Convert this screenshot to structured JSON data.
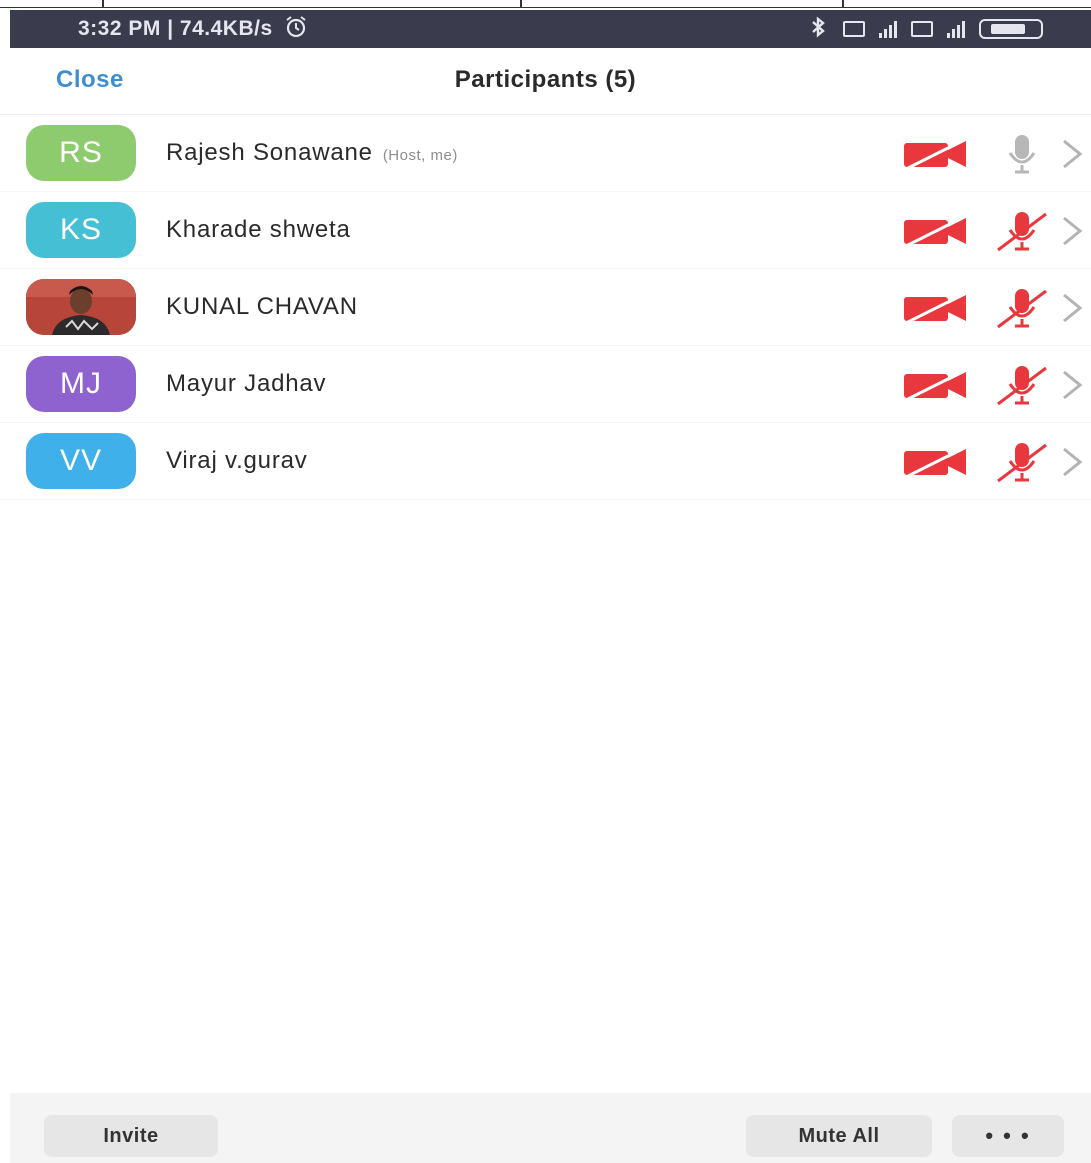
{
  "status_bar": {
    "time_speed": "3:32 PM | 74.4KB/s",
    "icons": [
      "alarm-icon",
      "bluetooth-icon",
      "volte-icon",
      "signal-icon",
      "volte-icon",
      "signal-icon",
      "battery-icon"
    ]
  },
  "header": {
    "close_label": "Close",
    "title": "Participants (5)"
  },
  "participants": [
    {
      "initials": "RS",
      "name": "Rajesh Sonawane",
      "tag": "(Host, me)",
      "avatar_color": "#8ecb6e",
      "video": "off",
      "audio": "unmuted-idle"
    },
    {
      "initials": "KS",
      "name": "Kharade shweta",
      "tag": "",
      "avatar_color": "#45bfd3",
      "video": "off",
      "audio": "muted"
    },
    {
      "initials": "",
      "name": "KUNAL CHAVAN",
      "tag": "",
      "avatar_color": "#b7453a",
      "video": "off",
      "audio": "muted",
      "photo": true
    },
    {
      "initials": "MJ",
      "name": "Mayur Jadhav",
      "tag": "",
      "avatar_color": "#8f63cf",
      "video": "off",
      "audio": "muted"
    },
    {
      "initials": "VV",
      "name": "Viraj v.gurav",
      "tag": "",
      "avatar_color": "#3fb0ea",
      "video": "off",
      "audio": "muted"
    }
  ],
  "footer": {
    "invite_label": "Invite",
    "mute_all_label": "Mute All",
    "more_label": "• • •"
  },
  "colors": {
    "accent": "#3e8ecf",
    "muted_red": "#e8383d",
    "status_bar": "#3a3c4e"
  }
}
